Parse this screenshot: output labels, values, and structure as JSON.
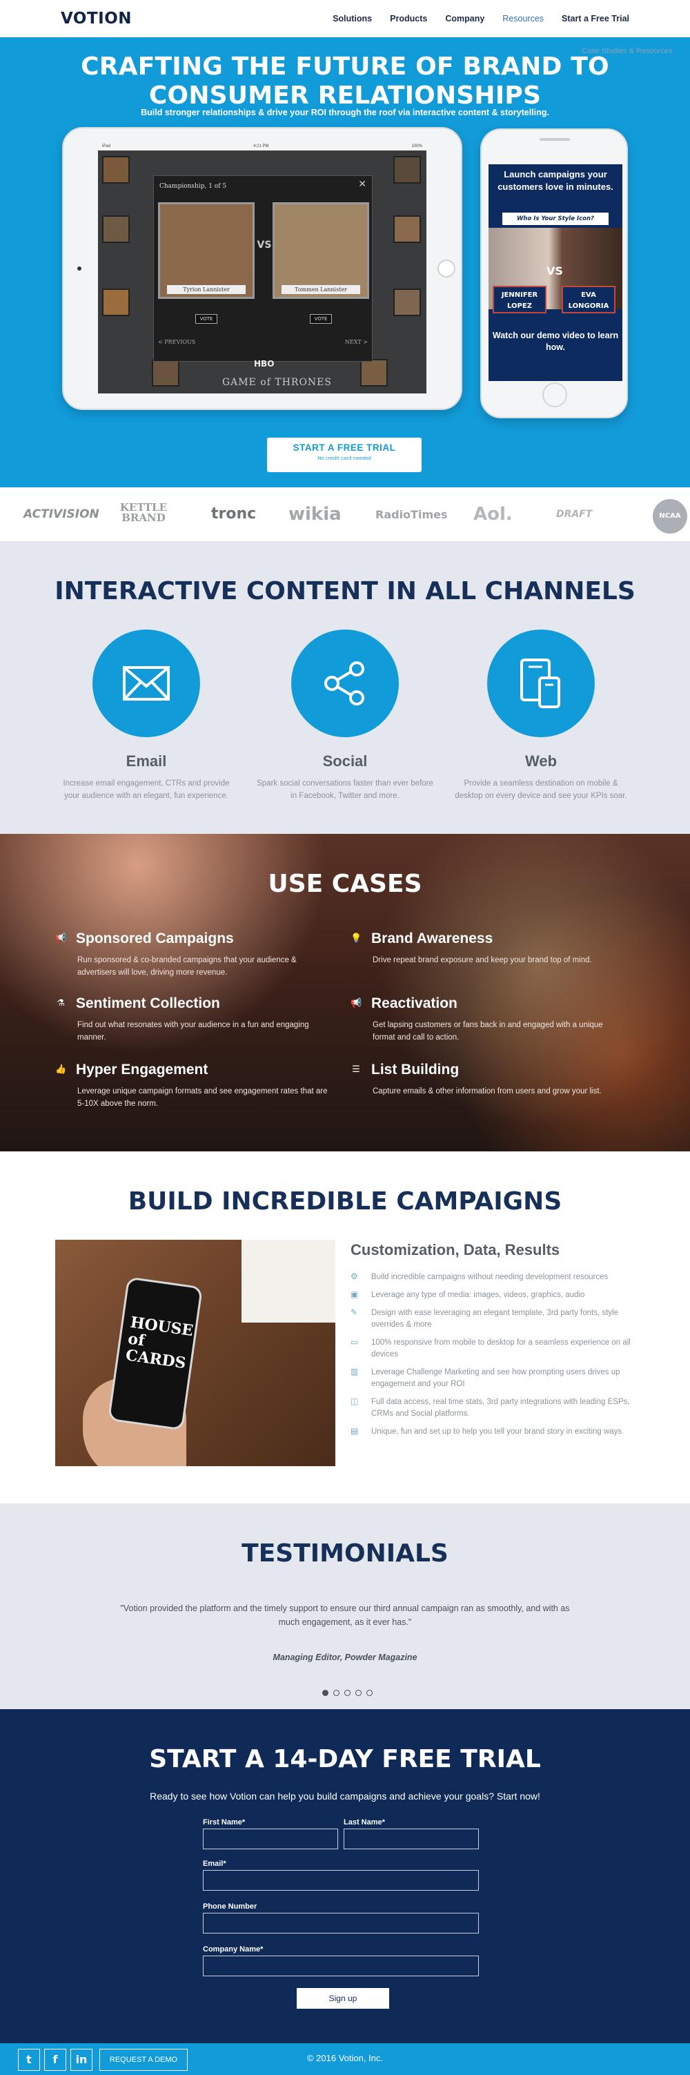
{
  "nav": {
    "logo": "VOTION",
    "links": [
      "Solutions",
      "Products",
      "Company",
      "Resources",
      "Start a Free Trial"
    ],
    "submenu": "Case Studies & Resources"
  },
  "hero": {
    "title_line1": "CRAFTING THE FUTURE OF BRAND TO",
    "title_line2": "CONSUMER RELATIONSHIPS",
    "subtitle": "Build stronger relationships & drive your ROI through the roof via interactive content & storytelling.",
    "ipad": {
      "status_left": "iPad",
      "status_time": "4:21 PM",
      "status_right": "100%",
      "modal_title": "Championship, 1 of 5",
      "left_name": "Tyrion Lannister",
      "right_name": "Tommen Lannister",
      "vs": "VS",
      "vote": "VOTE",
      "previous": "< PREVIOUS",
      "next": "NEXT >",
      "hbo": "HBO",
      "show": "GAME of THRONES"
    },
    "iphone": {
      "launch": "Launch campaigns your customers love in minutes.",
      "style_question": "Who Is Your Style Icon?",
      "vs": "VS",
      "left_name": "JENNIFER LOPEZ",
      "right_name": "EVA LONGORIA",
      "watch": "Watch our demo video to learn how."
    },
    "cta_label": "START A FREE TRIAL",
    "cta_note": "No credit card needed"
  },
  "logos": [
    "ACTIVISION",
    "KETTLE BRAND",
    "tronc",
    "wikia",
    "RadioTimes",
    "Aol.",
    "DRAFT",
    "NCAA"
  ],
  "channels": {
    "heading": "INTERACTIVE CONTENT IN ALL CHANNELS",
    "items": [
      {
        "icon": "envelope-icon",
        "title": "Email",
        "text": "Increase email engagement, CTRs and provide your audience with an elegant, fun experience."
      },
      {
        "icon": "share-icon",
        "title": "Social",
        "text": "Spark social conversations faster than ever before in Facebook, Twitter and more."
      },
      {
        "icon": "devices-icon",
        "title": "Web",
        "text": "Provide a seamless destination on mobile & desktop on every device and see your KPIs soar."
      }
    ]
  },
  "usecases": {
    "heading": "USE CASES",
    "items": [
      {
        "icon": "megaphone-icon",
        "title": "Sponsored Campaigns",
        "text": "Run sponsored & co-branded campaigns that your audience & advertisers will love, driving more revenue."
      },
      {
        "icon": "lightbulb-icon",
        "title": "Brand Awareness",
        "text": "Drive repeat brand exposure and keep your brand top of mind."
      },
      {
        "icon": "flask-icon",
        "title": "Sentiment Collection",
        "text": "Find out what resonates with your audience in a fun and engaging manner."
      },
      {
        "icon": "megaphone-icon",
        "title": "Reactivation",
        "text": "Get lapsing customers or fans back in and engaged with a unique format and call to action."
      },
      {
        "icon": "thumbs-up-icon",
        "title": "Hyper Engagement",
        "text": "Leverage unique campaign formats and see engagement rates that are 5-10X above the norm."
      },
      {
        "icon": "list-icon",
        "title": "List Building",
        "text": "Capture emails & other information from users and grow your list."
      }
    ]
  },
  "build": {
    "heading": "BUILD INCREDIBLE CAMPAIGNS",
    "photo_text": "HOUSE of CARDS",
    "subheading": "Customization, Data, Results",
    "features": [
      "Build incredible campaigns without needing development resources",
      "Leverage any type of media: images, videos, graphics, audio",
      "Design with ease leveraging an elegant template, 3rd party fonts, style overrides & more",
      "100% responsive from mobile to desktop for a seamless experience on all devices",
      "Leverage Challenge Marketing and see how prompting users drives up engagement and your ROI",
      "Full data access, real time stats, 3rd party integrations with leading ESPs, CRMs and Social platforms.",
      "Unique, fun and set up to help you tell your brand story in exciting ways"
    ]
  },
  "testimonials": {
    "heading": "TESTIMONIALS",
    "quote": "\"Votion provided the platform and the timely support to ensure our third annual campaign ran as smoothly, and with as much engagement, as it ever has.\"",
    "author": "Managing Editor, Powder Magazine",
    "active_slide": 1,
    "slide_count": 5
  },
  "trial": {
    "heading": "START A 14-DAY FREE TRIAL",
    "subtitle": "Ready to see how Votion can help you build campaigns and achieve your goals? Start now!",
    "fields": {
      "first_name": "First Name*",
      "last_name": "Last Name*",
      "email": "Email*",
      "phone": "Phone Number",
      "company": "Company Name*"
    },
    "submit": "Sign up"
  },
  "footer": {
    "social": [
      "twitter-icon",
      "facebook-icon",
      "linkedin-icon"
    ],
    "demo": "REQUEST A DEMO",
    "copyright": "© 2016 Votion, Inc."
  },
  "colors": {
    "brand_blue": "#129bd9",
    "navy": "#0f2a57",
    "heading_navy": "#17305a",
    "light_gray_bg": "#e4e7ee"
  }
}
